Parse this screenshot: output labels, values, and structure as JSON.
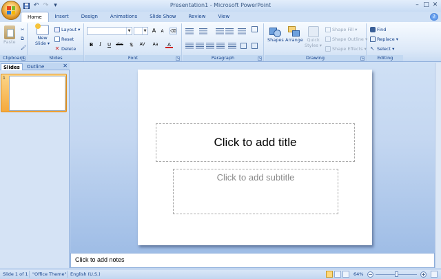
{
  "window": {
    "title": "Presentation1 - Microsoft PowerPoint",
    "controls": {
      "minimize": "–",
      "maximize": "□",
      "close": "✕"
    }
  },
  "quick_access": {
    "save_icon": "save-icon",
    "undo_icon": "undo-icon",
    "redo_icon": "redo-icon",
    "customize": "▾"
  },
  "tabs": [
    "Home",
    "Insert",
    "Design",
    "Animations",
    "Slide Show",
    "Review",
    "View"
  ],
  "ribbon": {
    "clipboard": {
      "label": "Clipboard",
      "paste": "Paste"
    },
    "slides": {
      "label": "Slides",
      "new_slide": "New",
      "new_slide_2": "Slide ▾",
      "layout": "Layout ▾",
      "reset": "Reset",
      "delete": "Delete"
    },
    "font": {
      "label": "Font",
      "grow": "A",
      "shrink": "A",
      "clear": "⌫",
      "bold": "B",
      "italic": "I",
      "underline": "U",
      "strike": "abc",
      "shadow": "S",
      "spacing": "AV",
      "case": "Aa",
      "color": "A"
    },
    "paragraph": {
      "label": "Paragraph"
    },
    "drawing": {
      "label": "Drawing",
      "shapes": "Shapes",
      "arrange": "Arrange",
      "quick_styles": "Quick",
      "quick_styles_2": "Styles ▾",
      "shape_fill": "Shape Fill ▾",
      "shape_outline": "Shape Outline ▾",
      "shape_effects": "Shape Effects ▾"
    },
    "editing": {
      "label": "Editing",
      "find": "Find",
      "replace": "Replace ▾",
      "select": "Select ▾"
    }
  },
  "left_pane": {
    "tab_slides": "Slides",
    "tab_outline": "Outline",
    "close": "✕",
    "slide_number": "1"
  },
  "slide": {
    "title_placeholder": "Click to add title",
    "subtitle_placeholder": "Click to add subtitle"
  },
  "notes": {
    "placeholder": "Click to add notes"
  },
  "status": {
    "slide": "Slide 1 of 1",
    "theme": "\"Office Theme\"",
    "language": "English (U.S.)",
    "zoom": "64%",
    "zoom_out": "−",
    "zoom_in": "+"
  },
  "colors": {
    "accent": "#15428b",
    "ribbon_bg": "#dde9f8",
    "workspace": "#c4d7f1",
    "selected_thumb": "#f5a93c"
  }
}
